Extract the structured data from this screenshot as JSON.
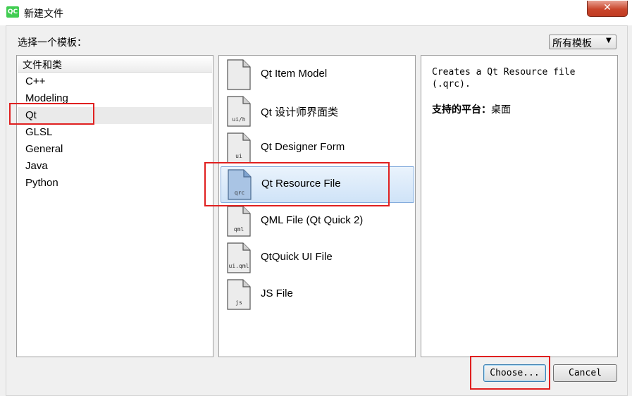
{
  "window": {
    "title": "新建文件",
    "app_logo": "QC",
    "close_label": "✕"
  },
  "prompt": "选择一个模板：",
  "filter": {
    "selected": "所有模板"
  },
  "categories": {
    "header": "文件和类",
    "items": [
      "C++",
      "Modeling",
      "Qt",
      "GLSL",
      "General",
      "Java",
      "Python"
    ],
    "selected": "Qt"
  },
  "templates": {
    "items": [
      {
        "label": "Qt Item Model",
        "ext": ""
      },
      {
        "label": "Qt 设计师界面类",
        "ext": "ui/h"
      },
      {
        "label": "Qt Designer Form",
        "ext": "ui"
      },
      {
        "label": "Qt Resource File",
        "ext": "qrc"
      },
      {
        "label": "QML File (Qt Quick 2)",
        "ext": "qml"
      },
      {
        "label": "QtQuick UI File",
        "ext": "ui.qml"
      },
      {
        "label": "JS File",
        "ext": "js"
      }
    ],
    "selected": "Qt Resource File"
  },
  "description": {
    "text": "Creates a Qt Resource file (.qrc).",
    "platform_label": "支持的平台：",
    "platform_value": "桌面"
  },
  "buttons": {
    "choose": "Choose...",
    "cancel": "Cancel"
  },
  "colors": {
    "highlight_box": "#e02020",
    "selection_blue": "#cfe3f8",
    "qt_green": "#41cd52"
  }
}
